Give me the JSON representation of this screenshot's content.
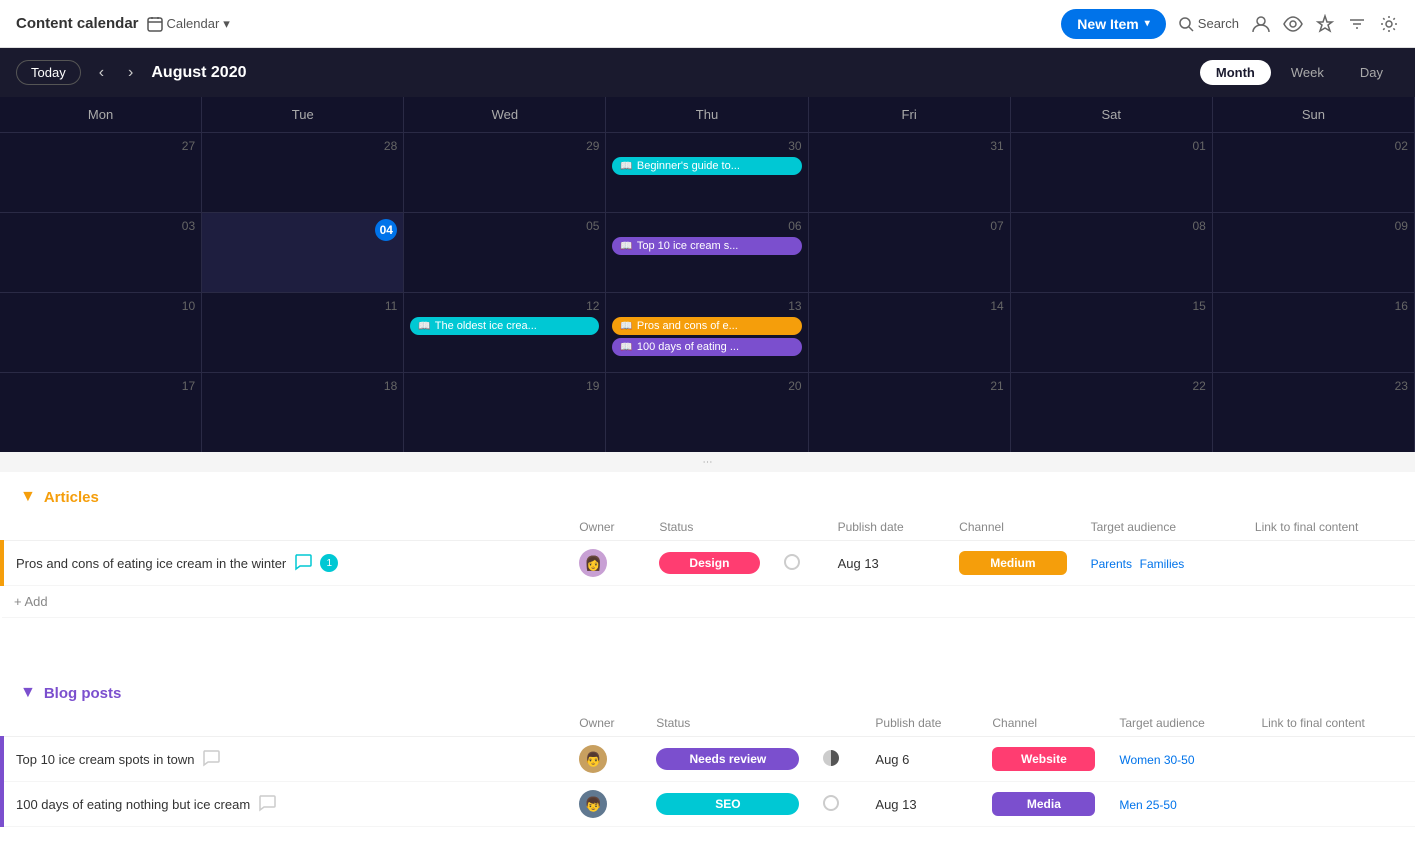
{
  "app": {
    "title": "Content calendar",
    "view_selector": "Calendar",
    "view_selector_arrow": "▾"
  },
  "toolbar": {
    "new_item_label": "New Item",
    "new_item_arrow": "▾",
    "search_label": "Search"
  },
  "icons": {
    "user": "👤",
    "eye": "👁",
    "pin": "📌",
    "filter": "☰",
    "settings": "⚙",
    "calendar": "📅",
    "search": "🔍",
    "comment_active": "💬",
    "comment_inactive": "💬",
    "grid": "⋮⋮⋮",
    "chevron_left": "‹",
    "chevron_right": "›",
    "collapse_open": "▼",
    "collapse_closed": "▶",
    "book": "📖"
  },
  "calendar": {
    "today_label": "Today",
    "current_month": "August 2020",
    "views": [
      {
        "label": "Month",
        "active": true
      },
      {
        "label": "Week",
        "active": false
      },
      {
        "label": "Day",
        "active": false
      }
    ],
    "headers": [
      "Mon",
      "Tue",
      "Wed",
      "Thu",
      "Fri",
      "Sat",
      "Sun"
    ],
    "rows": [
      [
        {
          "date": "27",
          "today": false,
          "events": []
        },
        {
          "date": "28",
          "today": false,
          "events": []
        },
        {
          "date": "29",
          "today": false,
          "events": []
        },
        {
          "date": "30",
          "today": false,
          "events": [
            {
              "label": "Beginner's guide to...",
              "color": "cyan"
            }
          ]
        },
        {
          "date": "31",
          "today": false,
          "events": []
        },
        {
          "date": "01",
          "today": false,
          "events": []
        },
        {
          "date": "02",
          "today": false,
          "events": []
        }
      ],
      [
        {
          "date": "03",
          "today": false,
          "events": []
        },
        {
          "date": "04",
          "today": true,
          "events": []
        },
        {
          "date": "05",
          "today": false,
          "events": []
        },
        {
          "date": "06",
          "today": false,
          "events": [
            {
              "label": "Top 10 ice cream s...",
              "color": "purple"
            }
          ]
        },
        {
          "date": "07",
          "today": false,
          "events": []
        },
        {
          "date": "08",
          "today": false,
          "events": []
        },
        {
          "date": "09",
          "today": false,
          "events": []
        }
      ],
      [
        {
          "date": "10",
          "today": false,
          "events": []
        },
        {
          "date": "11",
          "today": false,
          "events": []
        },
        {
          "date": "12",
          "today": false,
          "events": [
            {
              "label": "The oldest ice crea...",
              "color": "cyan"
            }
          ]
        },
        {
          "date": "13",
          "today": false,
          "events": [
            {
              "label": "Pros and cons of e...",
              "color": "orange"
            },
            {
              "label": "100 days of eating ...",
              "color": "purple"
            }
          ]
        },
        {
          "date": "14",
          "today": false,
          "events": []
        },
        {
          "date": "15",
          "today": false,
          "events": []
        },
        {
          "date": "16",
          "today": false,
          "events": []
        }
      ],
      [
        {
          "date": "17",
          "today": false,
          "events": []
        },
        {
          "date": "18",
          "today": false,
          "events": []
        },
        {
          "date": "19",
          "today": false,
          "events": []
        },
        {
          "date": "20",
          "today": false,
          "events": []
        },
        {
          "date": "21",
          "today": false,
          "events": []
        },
        {
          "date": "22",
          "today": false,
          "events": []
        },
        {
          "date": "23",
          "today": false,
          "events": []
        }
      ]
    ]
  },
  "articles": {
    "section_title": "Articles",
    "collapse_icon": "▼",
    "columns": {
      "name": "",
      "owner": "Owner",
      "status": "Status",
      "publish_date": "Publish date",
      "channel": "Channel",
      "target_audience": "Target audience",
      "link": "Link to final content"
    },
    "items": [
      {
        "name": "Pros and cons of eating ice cream in the winter",
        "owner_emoji": "👩",
        "owner_color": "#c8a0d4",
        "status": "Design",
        "status_class": "status-design",
        "notify": "circle",
        "publish_date": "Aug 13",
        "channel": "Medium",
        "channel_class": "channel-medium",
        "tags": [
          "Parents",
          "Families"
        ],
        "has_comment": true
      }
    ],
    "add_label": "+ Add"
  },
  "blog_posts": {
    "section_title": "Blog posts",
    "collapse_icon": "▼",
    "columns": {
      "name": "",
      "owner": "Owner",
      "status": "Status",
      "publish_date": "Publish date",
      "channel": "Channel",
      "target_audience": "Target audience",
      "link": "Link to final content"
    },
    "items": [
      {
        "name": "Top 10 ice cream spots in town",
        "owner_emoji": "👨",
        "owner_color": "#c8a060",
        "status": "Needs review",
        "status_class": "status-needs-review",
        "notify": "half",
        "publish_date": "Aug 6",
        "channel": "Website",
        "channel_class": "channel-website",
        "tags": [
          "Women 30-50"
        ],
        "has_comment": false
      },
      {
        "name": "100 days of eating nothing but ice cream",
        "owner_emoji": "👦",
        "owner_color": "#607890",
        "status": "SEO",
        "status_class": "status-seo",
        "notify": "circle",
        "publish_date": "Aug 13",
        "channel": "Media",
        "channel_class": "channel-media",
        "tags": [
          "Men 25-50"
        ],
        "has_comment": false
      }
    ]
  }
}
